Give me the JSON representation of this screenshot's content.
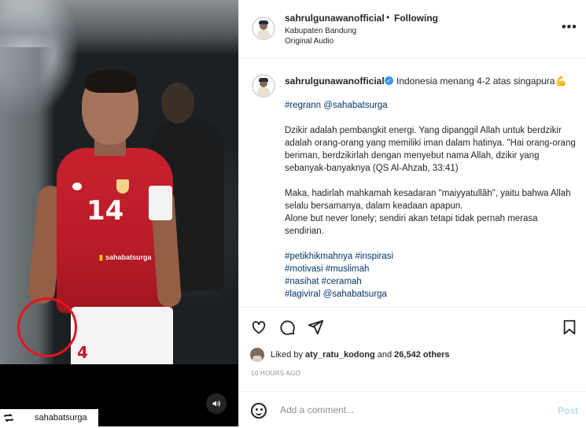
{
  "media": {
    "watermark_text": "sahabatsurga",
    "jersey_number": "14",
    "shorts_number": "4",
    "repost_username": "sahabatsurga",
    "repost_icon": "repost-icon",
    "sound_icon": "speaker-icon"
  },
  "header": {
    "username": "sahrulgunawanofficial",
    "separator": "•",
    "follow_status": "Following",
    "location": "Kabupaten Bandung",
    "audio": "Original Audio",
    "more_icon": "more-options-icon",
    "more_label": "•••"
  },
  "caption": {
    "username": "sahrulgunawanofficial",
    "verified_mark": "✓",
    "first_line": "Indonesia menang 4-2 atas singapura💪",
    "regram": "#regrann @sahabatsurga",
    "paragraph1": "Dzikir adalah pembangkit energi. Yang dipanggil Allah untuk berdzikir adalah orang-orang yang memiliki iman dalam hatinya. \"Hai orang-orang beriman, berdzikirlah dengan menyebut nama Allah, dzikir yang sebanyak-banyaknya (QS Al-Ahzab, 33:41)",
    "paragraph2_line1": "Maka, hadirlah mahkamah kesadaran \"maiyyatullâh\", yaitu bahwa Allah selalu bersamanya, dalam keadaan apapun.",
    "paragraph2_line2": "Alone but never lonely; sendiri akan tetapi tidak pernah merasa sendirian.",
    "tags_line1": "#petikhikmahnya #inspirasi",
    "tags_line2": "#motivasi #muslimah",
    "tags_line3": "#nasihat #ceramah",
    "tags_line4": "#lagiviral @sahabatsurga"
  },
  "actions": {
    "like_icon": "heart-icon",
    "comment_icon": "comment-icon",
    "share_icon": "share-icon",
    "save_icon": "bookmark-icon",
    "liked_prefix": "Liked by",
    "liked_user": "aty_ratu_kodong",
    "liked_and": "and",
    "liked_count": "26,542 others",
    "timestamp": "10 HOURS AGO"
  },
  "comment": {
    "emoji_icon": "emoji-icon",
    "placeholder": "Add a comment...",
    "post_label": "Post"
  }
}
